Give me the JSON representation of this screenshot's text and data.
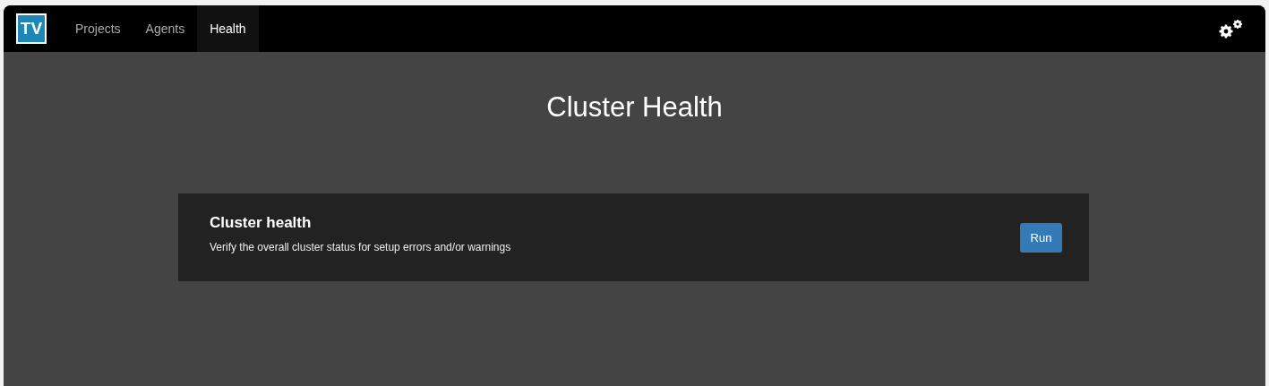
{
  "logo": {
    "text": "TV"
  },
  "tabs": [
    {
      "label": "Projects",
      "selected": false
    },
    {
      "label": "Agents",
      "selected": false
    },
    {
      "label": "Health",
      "selected": true
    }
  ],
  "page": {
    "title": "Cluster Health"
  },
  "checks": [
    {
      "title": "Cluster health",
      "description": "Verify the overall cluster status for setup errors and/or warnings",
      "button": "Run"
    }
  ]
}
